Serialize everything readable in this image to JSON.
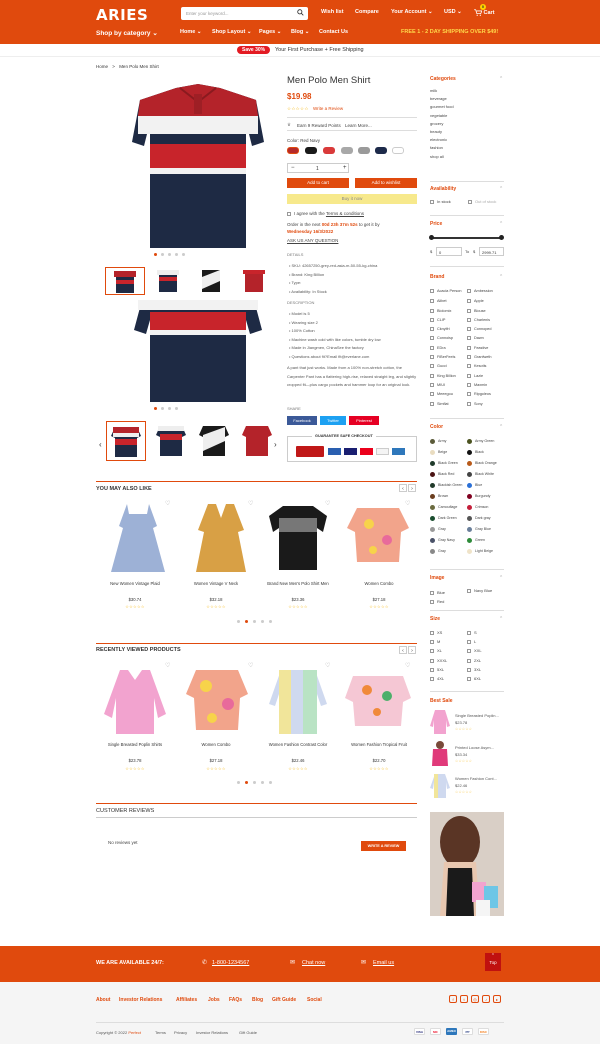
{
  "header": {
    "logo": "ARIES",
    "search_placeholder": "Enter your keyword...",
    "wishlist": "Wish list",
    "compare": "Compare",
    "account": "Your Account",
    "currency": "USD",
    "cart": "Cart",
    "cart_count": "0",
    "category": "Shop by category",
    "nav": [
      "Home",
      "Shop Layout",
      "Pages",
      "Blog",
      "Contact Us"
    ],
    "shipping": "FREE 1 - 2 DAY SHIPPING OVER $49!"
  },
  "promo": {
    "badge": "Save 30%",
    "text": "Your First Purchase + Free Shipping"
  },
  "breadcrumb": {
    "home": "Home",
    "sep": ">",
    "current": "Men Polo Men Shirt"
  },
  "product": {
    "title": "Men Polo Men Shirt",
    "price": "$19.98",
    "review_link": "Write a Review",
    "reward": "Earn 9 Reward Points",
    "learn_more": "Learn More...",
    "color_label": "Color: Red Navy",
    "qty": "1",
    "add_to_cart": "Add to cart",
    "add_to_wishlist": "Add to wishlist",
    "buy_now": "Buy it now",
    "agree_text": "I agree with the",
    "terms": "Terms & conditions",
    "order_text": "Order in the next",
    "order_time": "00d 23h 37m 52s",
    "order_text2": "to get it by",
    "order_date": "Wednesday 16/3/2022",
    "ask": "ASK US ANY QUESTION",
    "details_label": "DETAILS",
    "details": [
      "SKU: 42657250-grey-red-asia-m-50-55-kg-china",
      "Brand: King Billion",
      "Type:",
      "Availability: In Stock"
    ],
    "description_label": "DESCRIPTION",
    "description_bullets": [
      "Model is 5",
      "Wearing size 2",
      "100% Cotton",
      "Machine wash cold with like colors, tumble dry low",
      "Made in Jiangmen, ChinaSee the factory",
      "Questions about fit?Email fit@everlane.com"
    ],
    "description_text": "A pant that just works. Made from a 100% non-stretch cotton, the Carpenter Pant has a flattering high-rise, relaxed straight leg, and slightly cropped fit—plus cargo pockets and hammer loop for an original look.",
    "share_label": "SHARE",
    "share": [
      "Facebook",
      "Twitter",
      "Pinterest"
    ],
    "guarantee": "GUARANTEE SAFE CHECKOUT",
    "swatch_colors": [
      "#b52a2a",
      "#1a1a1a",
      "#d93a3a",
      "#a8a8a8",
      "#9a9a9a",
      "#1d2a4a",
      "#ffffff"
    ]
  },
  "also_like": {
    "title": "YOU MAY ALSO LIKE",
    "items": [
      {
        "name": "New Women Vintage Plaid",
        "price": "$30.74"
      },
      {
        "name": "Women Vintage V Neck",
        "price": "$32.18"
      },
      {
        "name": "Brand New Men's Polo Shirt Men",
        "price": "$23.36"
      },
      {
        "name": "Women Combo",
        "price": "$27.18"
      }
    ]
  },
  "recently": {
    "title": "RECENTLY VIEWED PRODUCTS",
    "items": [
      {
        "name": "Single Breasted Poplin Shirts",
        "price": "$23.78"
      },
      {
        "name": "Women Combo",
        "price": "$27.18"
      },
      {
        "name": "Women Fashion Contrast Color",
        "price": "$22.46"
      },
      {
        "name": "Women Fashion Tropical Fruit",
        "price": "$22.70"
      }
    ]
  },
  "reviews": {
    "title": "CUSTOMER REVIEWS",
    "empty": "No reviews yet",
    "button": "WRITE A REVIEW"
  },
  "sidebar": {
    "categories_title": "Categories",
    "categories": [
      "milk",
      "beverage",
      "gourmet food",
      "vegetable",
      "grocery",
      "beauty",
      "electronic",
      "fashion",
      "shop all"
    ],
    "availability_title": "Availability",
    "in_stock": "In stock",
    "out_stock": "Out of stock",
    "price_title": "Price",
    "price_min": "0",
    "price_to": "To",
    "price_max": "2999.71",
    "brand_title": "Brand",
    "brands_left": [
      "Acacia Person",
      "Alibet",
      "Biolomix",
      "CLIP",
      "Cknylfri",
      "Connoisp",
      "EDra",
      "FiBerFeels",
      "Gucci",
      "King Billion",
      "MIUI",
      "Meeegou",
      "Simflat"
    ],
    "brands_right": [
      "Ambession",
      "Apple",
      "Blouse",
      "Charlenis",
      "Connoped",
      "Dawn",
      "Feastive",
      "Granfweth",
      "Kesotis",
      "Lazie",
      "Maxmin",
      "Ripgoleos",
      "Sony"
    ],
    "color_title": "Color",
    "colors_left": [
      [
        "Army",
        "#5b5b3a"
      ],
      [
        "Beige",
        "#e9dcc0"
      ],
      [
        "Black Green",
        "#1f3a2b"
      ],
      [
        "Black Red",
        "#4a1414"
      ],
      [
        "Blackish Green",
        "#213a2a"
      ],
      [
        "Brown",
        "#6b3e1f"
      ],
      [
        "Camouflage",
        "#6b6b40"
      ],
      [
        "Dark Green",
        "#1a4d2e"
      ],
      [
        "Gray",
        "#9a9a9a"
      ],
      [
        "Gray Navy",
        "#4a5268"
      ],
      [
        "Gray",
        "#888888"
      ]
    ],
    "colors_right": [
      [
        "Army Green",
        "#4b5320"
      ],
      [
        "Black",
        "#111111"
      ],
      [
        "Black Orange",
        "#b85a1a"
      ],
      [
        "Black White",
        "#444444"
      ],
      [
        "Blue",
        "#2a6fd6"
      ],
      [
        "Burgundy",
        "#800020"
      ],
      [
        "Crimson",
        "#c41e3a"
      ],
      [
        "Dark gray",
        "#555555"
      ],
      [
        "Gray Blue",
        "#6a7f9a"
      ],
      [
        "Green",
        "#2e8b3a"
      ],
      [
        "Light Beige",
        "#efe3c8"
      ]
    ],
    "image_title": "Image",
    "images_left": [
      "Blue",
      "Red"
    ],
    "images_right": [
      "Navy Blue"
    ],
    "size_title": "Size",
    "sizes_left": [
      "XS",
      "M",
      "XL",
      "XXXL",
      "5XL",
      "4XL"
    ],
    "sizes_right": [
      "S",
      "L",
      "XXL",
      "2XL",
      "3XL",
      "6XL"
    ],
    "bestsale_title": "Best Sale",
    "bestsale": [
      {
        "name": "Single Breasted Poplin...",
        "price": "$23.78"
      },
      {
        "name": "Printed Loose Asym...",
        "price": "$33.34"
      },
      {
        "name": "Women Fashion Cont...",
        "price": "$22.46"
      }
    ]
  },
  "footer": {
    "available": "WE ARE AVAILABLE 24/7:",
    "phone": "1-800-1234567",
    "chat": "Chat now",
    "email": "Email us",
    "top": "Top",
    "links": [
      "About",
      "Investor Relations",
      "Affiliates",
      "Jobs",
      "FAQs",
      "Blog",
      "Gift Guide",
      "Social"
    ],
    "copyright": "Copyright © 2022",
    "copyright_brand": "Perfect",
    "bottom_links": [
      "Terms",
      "Privacy",
      "Investor Relations",
      "Gift Guide"
    ],
    "payments": [
      "VISA",
      "MC",
      "AMEX",
      "PP",
      "DISC"
    ]
  }
}
